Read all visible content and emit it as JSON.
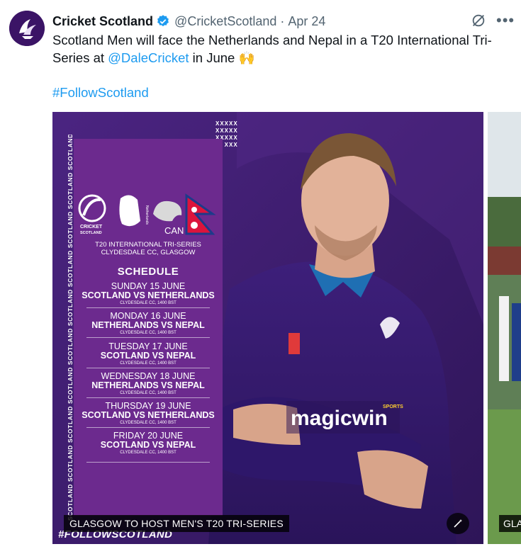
{
  "tweet": {
    "author_name": "Cricket Scotland",
    "handle": "@CricketScotland",
    "separator": "·",
    "date": "Apr 24",
    "text_before_mention": "Scotland Men will face the Netherlands and Nepal in a T20 International Tri-Series at ",
    "mention": "@DaleCricket",
    "text_after_mention": " in June 🙌",
    "hashtag": "#FollowScotland",
    "more_label": "•••"
  },
  "image1": {
    "caption": "GLASGOW TO HOST MEN'S T20 TRI-SERIES",
    "side_strip_text": "SCOTLAND SCOTLAND SCOTLAND SCOTLAND SCOTLAND SCOTLAND SCOTLAND SCOTLAND SCOTLAND SCOTLAND SCOTLAND SCOTLAND SCOTLAND SCOTLAND",
    "xgrid": "XXXXX\nXXXXX\nXXXXX\nXXX",
    "logo_cricket": "CRICKET",
    "logo_scotland": "SCOTLAND",
    "logo_netherlands": "Netherlands",
    "logo_can": "CAN",
    "series_line1": "T20 INTERNATIONAL TRI-SERIES",
    "series_line2": "CLYDESDALE CC, GLASGOW",
    "schedule_title": "SCHEDULE",
    "fixtures": [
      {
        "day": "SUNDAY 15 JUNE",
        "match": "SCOTLAND VS NETHERLANDS",
        "venue": "CLYDESDALE CC, 1400 BST"
      },
      {
        "day": "MONDAY 16 JUNE",
        "match": "NETHERLANDS VS NEPAL",
        "venue": "CLYDESDALE CC, 1400 BST"
      },
      {
        "day": "TUESDAY 17 JUNE",
        "match": "SCOTLAND VS NEPAL",
        "venue": "CLYDESDALE CC, 1400 BST"
      },
      {
        "day": "WEDNESDAY 18 JUNE",
        "match": "NETHERLANDS VS NEPAL",
        "venue": "CLYDESDALE CC, 1400 BST"
      },
      {
        "day": "THURSDAY 19 JUNE",
        "match": "SCOTLAND VS NETHERLANDS",
        "venue": "CLYDESDALE CC, 1400 BST"
      },
      {
        "day": "FRIDAY 20 JUNE",
        "match": "SCOTLAND VS NEPAL",
        "venue": "CLYDESDALE CC, 1400 BST"
      }
    ],
    "footer_hashtag": "#FOLLOWSCOTLAND",
    "sponsor": "magicwin",
    "sponsor_small": "SPORTS"
  },
  "image2": {
    "caption": "GLA"
  },
  "colors": {
    "text": "#0f1419",
    "muted": "#536471",
    "link": "#1d9bf0",
    "brand_purple": "#3a1c6b",
    "panel_purple": "#6c2a8e",
    "verified": "#1d9bf0"
  },
  "icons": [
    "verified-badge-icon",
    "grok-icon",
    "more-icon",
    "alt-edit-icon"
  ]
}
